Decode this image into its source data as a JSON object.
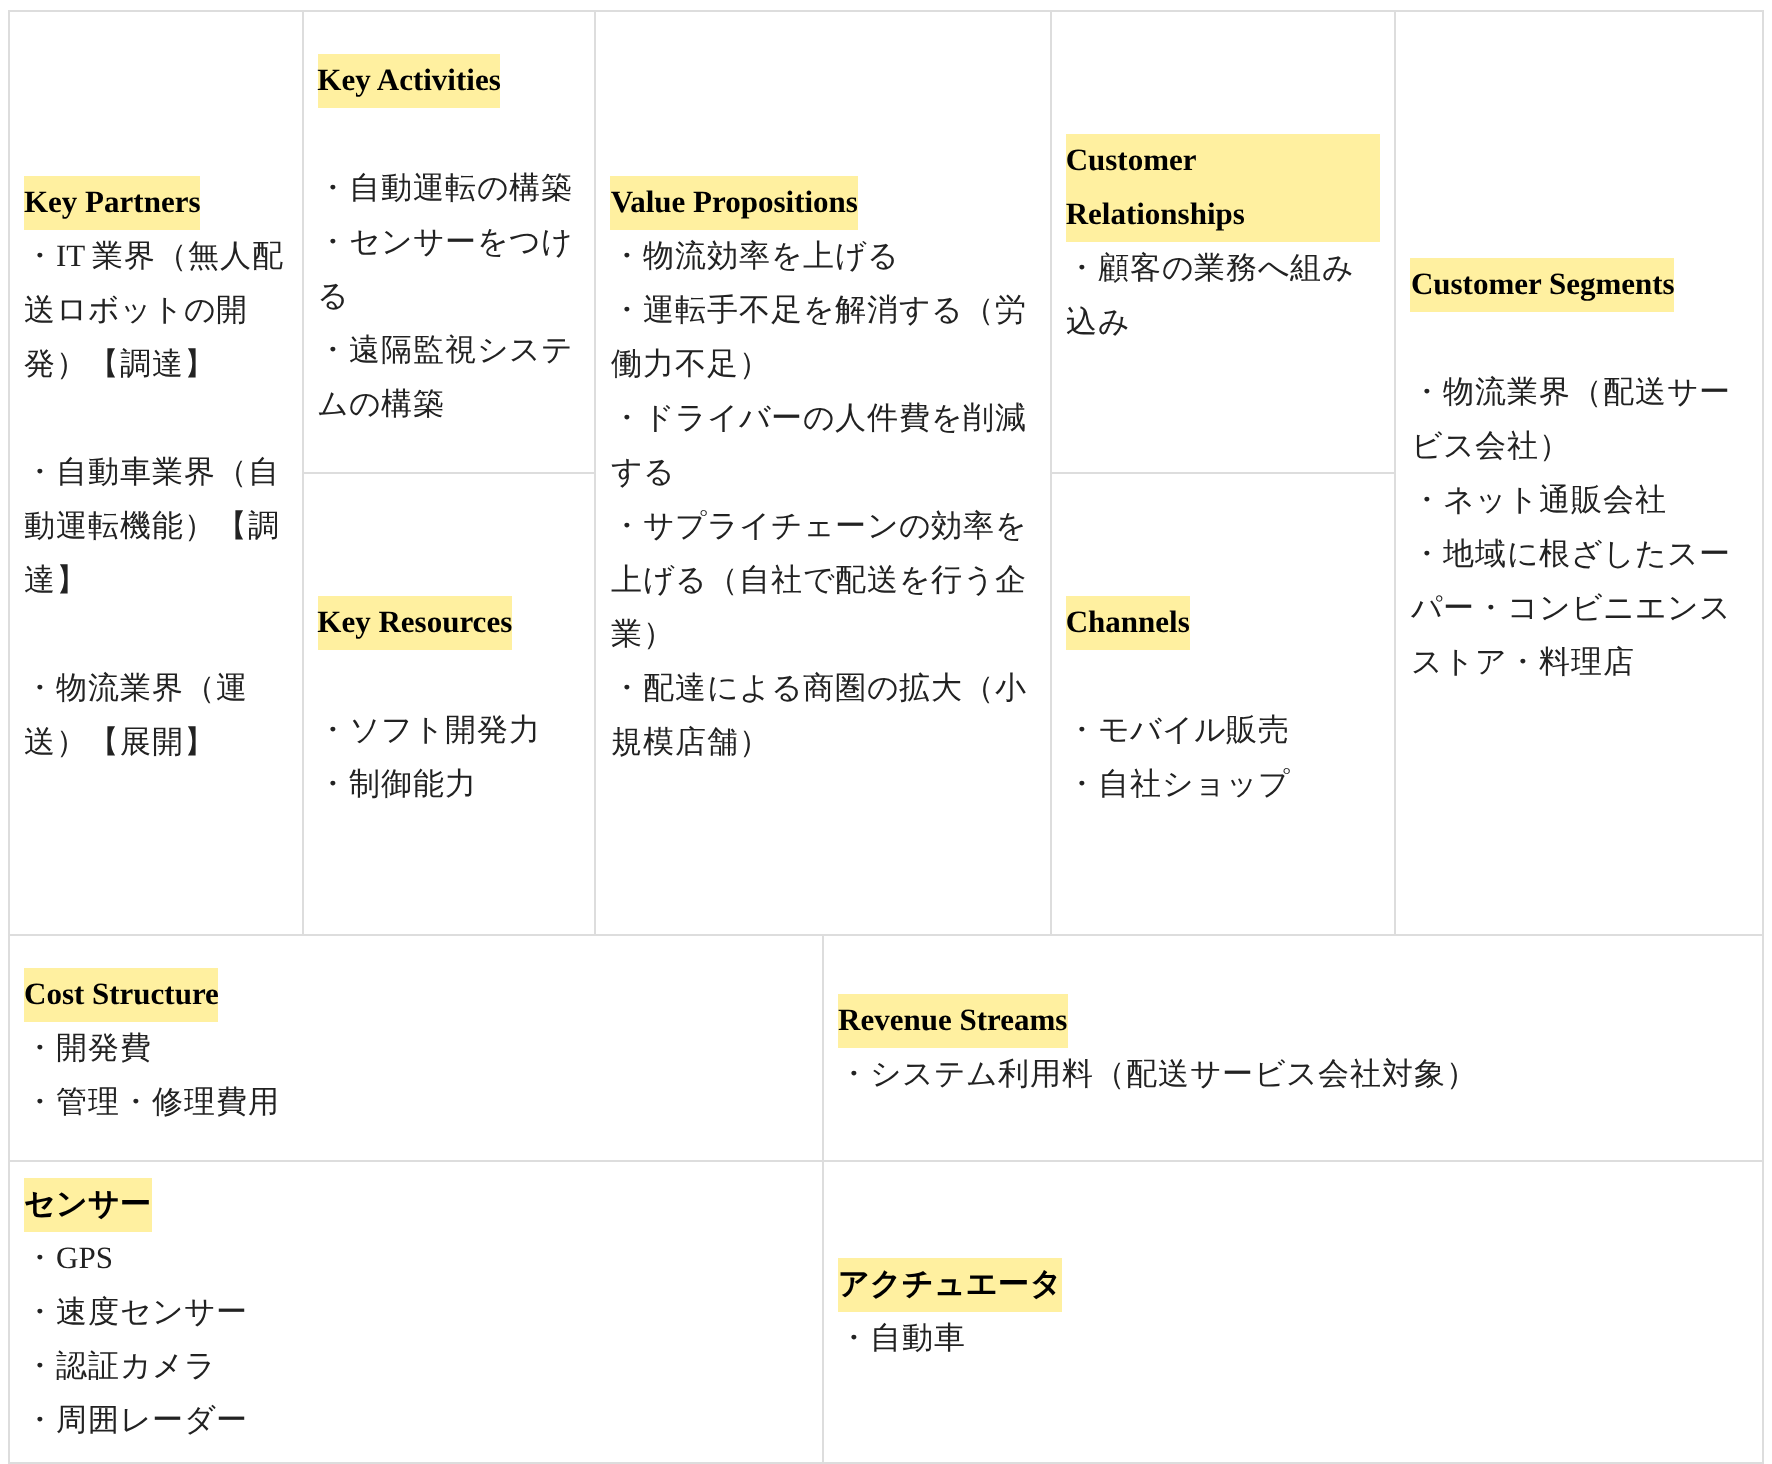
{
  "top_columns": [
    {
      "cells": [
        {
          "title": "Key Partners",
          "kind": "spaced",
          "items": [
            "・IT 業界（無人配送ロボットの開発）【調達】",
            "・自動車業界（自動運転機能）【調達】",
            "・物流業界（運送）【展開】"
          ]
        }
      ]
    },
    {
      "cells": [
        {
          "title": "Key Activities",
          "kind": "gap",
          "items": [
            "・自動運転の構築",
            "・センサーをつける",
            "・遠隔監視システムの構築"
          ]
        },
        {
          "title": "Key Resources",
          "kind": "gap",
          "items": [
            "・ソフト開発力",
            "・制御能力"
          ]
        }
      ]
    },
    {
      "cells": [
        {
          "title": "Value Propositions",
          "kind": "plain",
          "items": [
            "・物流効率を上げる",
            "・運転手不足を解消する（労働力不足）",
            "・ドライバーの人件費を削減する",
            "・サプライチェーンの効率を上げる（自社で配送を行う企業）",
            "・配達による商圏の拡大（小規模店舗）"
          ]
        }
      ]
    },
    {
      "cells": [
        {
          "title": "Customer Relationships",
          "kind": "plain",
          "items": [
            "・顧客の業務へ組み込み"
          ]
        },
        {
          "title": "Channels",
          "kind": "gap",
          "items": [
            "・モバイル販売",
            "・自社ショップ"
          ]
        }
      ]
    },
    {
      "cells": [
        {
          "title": "Customer Segments",
          "kind": "gap",
          "items": [
            "・物流業界（配送サービス会社）",
            "・ネット通販会社",
            "・地域に根ざしたスーパー・コンビニエンスストア・料理店"
          ]
        }
      ]
    }
  ],
  "bottom_rows": [
    {
      "cells": [
        {
          "title": "Cost Structure",
          "items": [
            "・開発費",
            "・管理・修理費用"
          ]
        },
        {
          "title": "Revenue Streams",
          "items": [
            "・システム利用料（配送サービス会社対象）"
          ]
        }
      ]
    },
    {
      "cells": [
        {
          "title": "センサー",
          "items": [
            "・GPS",
            "・速度センサー",
            "・認証カメラ",
            "・周囲レーダー"
          ]
        },
        {
          "title": "アクチュエータ",
          "items": [
            "・自動車"
          ]
        }
      ]
    }
  ]
}
